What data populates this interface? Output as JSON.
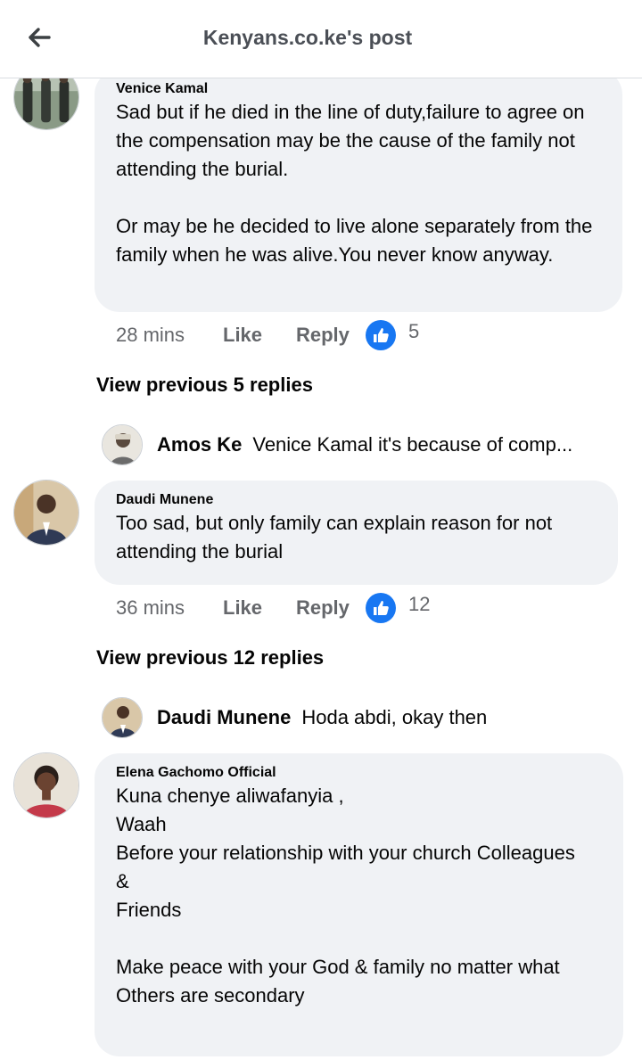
{
  "header": {
    "title": "Kenyans.co.ke's post",
    "back_icon": "arrow-left-icon"
  },
  "comments": [
    {
      "author": "Venice Kamal",
      "text": "Sad but if he died in the line of duty,failure to agree on the compensation may be the cause of the family not attending the burial.\n\nOr may be he decided to live alone separately from the family when he was alive.You never know anyway.",
      "time": "28 mins",
      "like_label": "Like",
      "reply_label": "Reply",
      "reaction_icon": "thumbs-up-icon",
      "reaction_count": "5",
      "view_previous": "View previous 5 replies",
      "latest_reply": {
        "author": "Amos Ke",
        "text": "Venice Kamal it's because of comp..."
      }
    },
    {
      "author": "Daudi Munene",
      "text": "Too sad, but only family can explain reason for not attending the burial",
      "time": "36 mins",
      "like_label": "Like",
      "reply_label": "Reply",
      "reaction_icon": "thumbs-up-icon",
      "reaction_count": "12",
      "view_previous": "View previous 12 replies",
      "latest_reply": {
        "author": "Daudi Munene",
        "text": "Hoda abdi, okay then"
      }
    },
    {
      "author": "Elena Gachomo Official",
      "text": "Kuna chenye aliwafanyia ,\nWaah\nBefore your relationship with your church Colleagues\n&\nFriends\n\nMake peace with your God & family no matter what Others are secondary"
    }
  ],
  "colors": {
    "accent": "#1877f2",
    "bubble": "#f0f2f5",
    "muted": "#65676b"
  }
}
